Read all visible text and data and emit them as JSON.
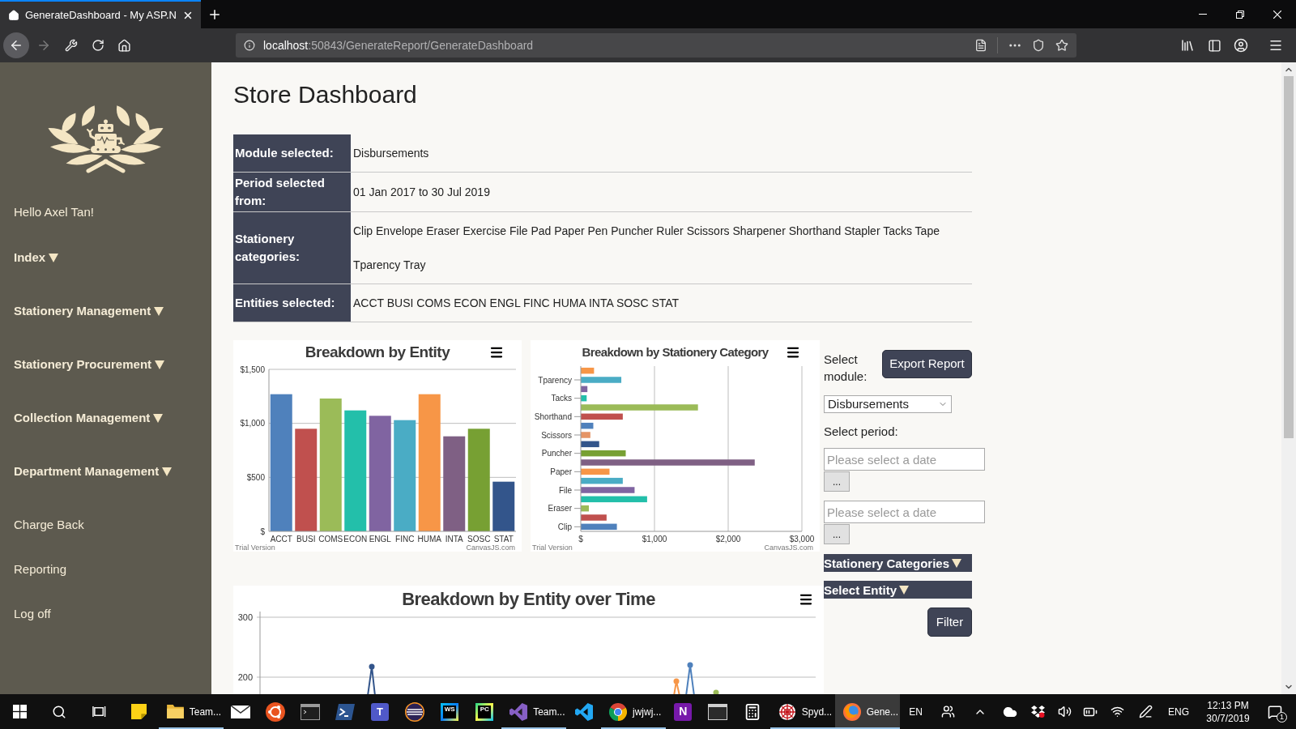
{
  "browser": {
    "tabs": [
      {
        "title": "GenerateDashboard - My ASP.N",
        "selected": true
      }
    ],
    "nav": {
      "back": {
        "disabled": false
      },
      "forward": {
        "disabled": true
      }
    },
    "url": {
      "host": "localhost",
      "path": ":50843/GenerateReport/GenerateDashboard"
    }
  },
  "sidebar": {
    "greeting": "Hello Axel Tan!",
    "items": [
      {
        "label": "Index",
        "kind": "dropdown"
      },
      {
        "label": "Stationery Management",
        "kind": "dropdown"
      },
      {
        "label": "Stationery Procurement",
        "kind": "dropdown"
      },
      {
        "label": "Collection Management",
        "kind": "dropdown"
      },
      {
        "label": "Department Management",
        "kind": "dropdown"
      },
      {
        "label": "Charge Back",
        "kind": "link"
      },
      {
        "label": "Reporting",
        "kind": "link"
      },
      {
        "label": "Log off",
        "kind": "link"
      }
    ]
  },
  "page": {
    "title": "Store Dashboard"
  },
  "summary": [
    {
      "label": "Module selected:",
      "value": "Disbursements"
    },
    {
      "label": "Period selected from:",
      "value": "01 Jan 2017 to 30 Jul 2019"
    },
    {
      "label": "Stationery categories:",
      "value": "Clip Envelope Eraser Exercise File Pad Paper Pen Puncher Ruler Scissors Sharpener Shorthand Stapler Tacks Tape Tparency Tray"
    },
    {
      "label": "Entities selected:",
      "value": "ACCT BUSI COMS ECON ENGL FINC HUMA INTA SOSC STAT"
    }
  ],
  "charts": [
    {
      "trial_label": "Trial Version",
      "credit": "CanvasJS.com",
      "chart_data": {
        "type": "bar",
        "title": "Breakdown by Entity",
        "categories": [
          "ACCT",
          "BUSI",
          "COMS",
          "ECON",
          "ENGL",
          "FINC",
          "HUMA",
          "INTA",
          "SOSC",
          "STAT"
        ],
        "values": [
          1270,
          950,
          1230,
          1120,
          1070,
          1030,
          1270,
          880,
          950,
          460
        ],
        "ylim": [
          0,
          1500
        ],
        "yticks": [
          {
            "value": 0,
            "label": "$"
          },
          {
            "value": 500,
            "label": "$500"
          },
          {
            "value": 1000,
            "label": "$1,000"
          },
          {
            "value": 1500,
            "label": "$1,500"
          }
        ]
      }
    },
    {
      "trial_label": "Trial Version",
      "credit": "CanvasJS.com",
      "chart_data": {
        "type": "bar",
        "orientation": "horizontal",
        "title": "Breakdown by Stationery Category",
        "categories": [
          null,
          "Tparency",
          null,
          "Tacks",
          null,
          "Shorthand",
          null,
          "Scissors",
          null,
          "Puncher",
          null,
          "Paper",
          null,
          "File",
          null,
          "Eraser",
          null,
          "Clip"
        ],
        "values": [
          180,
          550,
          90,
          80,
          1590,
          570,
          170,
          130,
          250,
          610,
          2360,
          390,
          570,
          730,
          900,
          110,
          350,
          490
        ],
        "xlim": [
          0,
          3000
        ],
        "xticks": [
          {
            "value": 0,
            "label": "$"
          },
          {
            "value": 1000,
            "label": "$1,000"
          },
          {
            "value": 2000,
            "label": "$2,000"
          },
          {
            "value": 3000,
            "label": "$3,000"
          }
        ]
      }
    }
  ],
  "time_chart": {
    "title": "Breakdown by Entity over Time",
    "y_labels": [
      "300",
      "200"
    ]
  },
  "filters": {
    "module_label": "Select module:",
    "export_button": "Export Report",
    "module_select": {
      "value": "Disbursements"
    },
    "period_label": "Select period:",
    "date_fields": [
      {
        "placeholder": "Please select a date",
        "button": "..."
      },
      {
        "placeholder": "Please select a date",
        "button": "..."
      }
    ],
    "toggles": [
      {
        "label": "Stationery Categories"
      },
      {
        "label": "Select Entity"
      }
    ],
    "filter_button": "Filter"
  },
  "taskbar": {
    "apps": [
      {
        "running": false,
        "selected": false
      },
      {
        "label": "Team...",
        "running": true,
        "selected": false
      },
      {
        "running": false,
        "selected": false
      },
      {
        "running": false,
        "selected": false
      },
      {
        "running": false,
        "selected": false
      },
      {
        "running": false,
        "selected": false
      },
      {
        "logo_text": "T",
        "running": false,
        "selected": false
      },
      {
        "running": false,
        "selected": false
      },
      {
        "logo_text": "WS",
        "running": false,
        "selected": false
      },
      {
        "logo_text": "PC",
        "running": false,
        "selected": false
      },
      {
        "label": "Team...",
        "running": true,
        "selected": false
      },
      {
        "running": false,
        "selected": false
      },
      {
        "label": "jwjwj...",
        "running": true,
        "selected": false
      },
      {
        "logo_text": "N",
        "running": false,
        "selected": false
      },
      {
        "running": false,
        "selected": false
      },
      {
        "running": false,
        "selected": false
      },
      {
        "label": "Spyd...",
        "running": true,
        "selected": false
      },
      {
        "label": "Gene...",
        "running": true,
        "selected": true
      }
    ],
    "tray": {
      "keyboard": "EN",
      "language": "ENG",
      "time": "12:13 PM",
      "date": "30/7/2019",
      "notifications": "1"
    }
  }
}
